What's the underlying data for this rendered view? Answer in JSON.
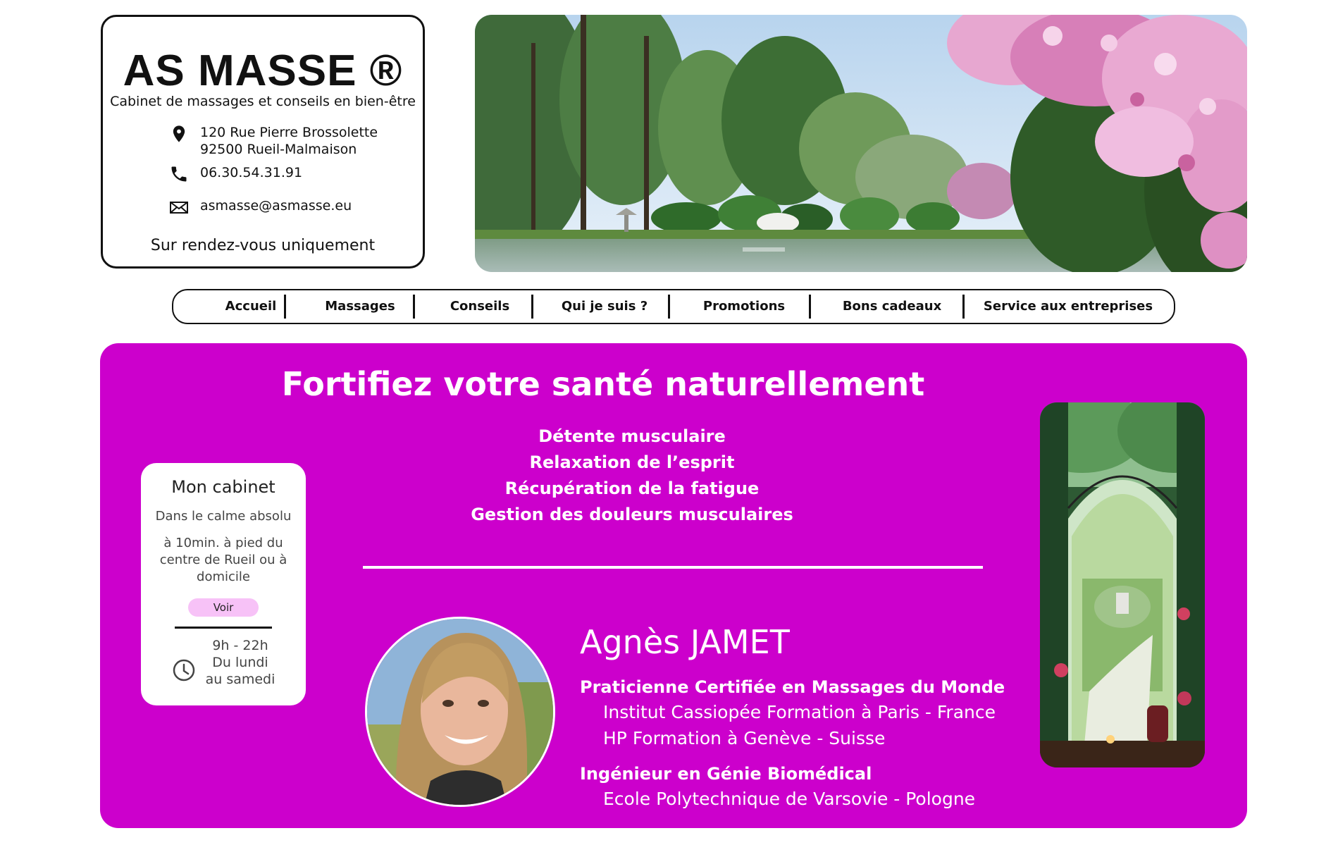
{
  "brand": {
    "title": "AS MASSE ®",
    "subtitle": "Cabinet de massages et conseils en bien-être",
    "address_line1": "120 Rue Pierre Brossolette",
    "address_line2": "92500 Rueil-Malmaison",
    "phone": "06.30.54.31.91",
    "email": "asmasse@asmasse.eu",
    "appointment": "Sur rendez-vous uniquement"
  },
  "nav": {
    "items": [
      {
        "label": "Accueil"
      },
      {
        "label": "Massages"
      },
      {
        "label": "Conseils"
      },
      {
        "label": "Qui je suis ?"
      },
      {
        "label": "Promotions"
      },
      {
        "label": "Bons cadeaux"
      },
      {
        "label": "Service aux entreprises"
      }
    ]
  },
  "main": {
    "headline": "Fortifiez votre santé naturellement",
    "benefits": [
      "Détente musculaire",
      "Relaxation de l’esprit",
      "Récupération de la fatigue",
      "Gestion des douleurs musculaires"
    ]
  },
  "cabinet": {
    "title": "Mon cabinet",
    "line1": "Dans le calme absolu",
    "line2": "à 10min. à pied du centre de Rueil ou à domicile",
    "button": "Voir",
    "hours_time": "9h - 22h",
    "hours_days1": "Du lundi",
    "hours_days2": "au samedi"
  },
  "bio": {
    "name": "Agnès JAMET",
    "role1": "Praticienne Certifiée en Massages du Monde",
    "detail1": "Institut Cassiopée Formation à Paris - France",
    "detail2": "HP Formation à Genève - Suisse",
    "role2": "Ingénieur en Génie Biomédical",
    "detail3": "Ecole Polytechnique de Varsovie - Pologne"
  },
  "colors": {
    "panel": "#cc00cc",
    "button_bg": "#f7c2f7",
    "text_dark": "#111111",
    "white": "#ffffff"
  },
  "icons": [
    "location-pin-icon",
    "phone-icon",
    "envelope-icon",
    "clock-icon"
  ]
}
